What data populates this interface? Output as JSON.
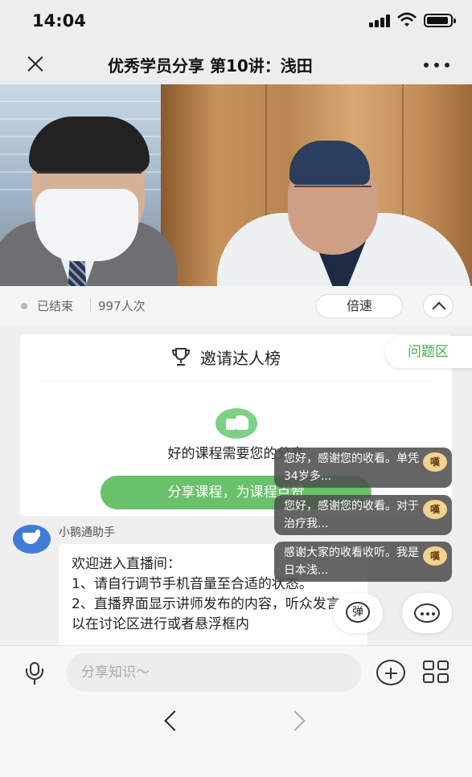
{
  "status_bar": {
    "time": "14:04"
  },
  "nav": {
    "title": "优秀学员分享 第10讲：浅田"
  },
  "video_info": {
    "status": "已结束",
    "viewers": "997人次",
    "speed_label": "倍速"
  },
  "invite_card": {
    "title": "邀请达人榜",
    "prompt": "好的课程需要您的分享",
    "share_button": "分享课程，为课程点赞"
  },
  "qa_button": "问题区",
  "chat": {
    "sender": "小鹅通助手",
    "lines": [
      "欢迎进入直播间：",
      "1、请自行调节手机音量至合适的状态。",
      "2、直播界面显示讲师发布的内容，听众发言可以在讨论区进行或者悬浮框内"
    ]
  },
  "floating_comments": [
    {
      "text": "您好，感谢您的收看。单凭34岁多...",
      "avatar_label": "嘆"
    },
    {
      "text": "您好，感谢您的收看。对于治疗我...",
      "avatar_label": "嘆"
    },
    {
      "text": "感谢大家的收看收听。我是日本浅...",
      "avatar_label": "嘆"
    }
  ],
  "controls": {
    "danmu_label": "弹"
  },
  "input": {
    "placeholder": "分享知识～"
  },
  "colors": {
    "accent_green": "#69c16a",
    "qa_green": "#42ad4d"
  },
  "icons": [
    "signal-icon",
    "wifi-icon",
    "battery-icon",
    "close-icon",
    "more-icon",
    "trophy-icon",
    "thumbs-up-icon",
    "mic-icon",
    "plus-icon",
    "grid-icon",
    "back-icon",
    "forward-icon"
  ]
}
